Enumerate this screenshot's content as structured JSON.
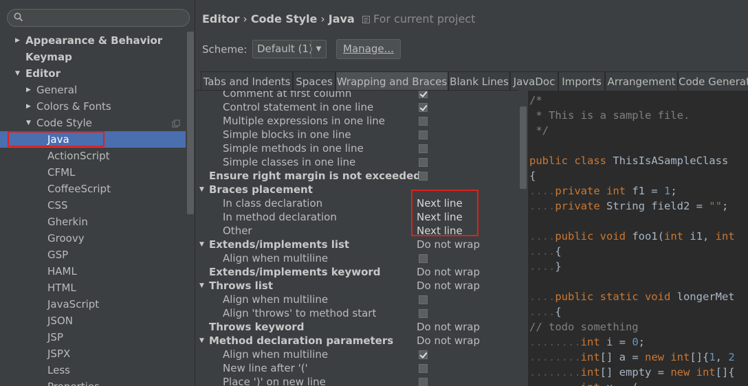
{
  "search": {
    "placeholder": ""
  },
  "sidebar": {
    "top": [
      {
        "label": "Appearance & Behavior",
        "arrow": "▶"
      },
      {
        "label": "Keymap",
        "arrow": ""
      },
      {
        "label": "Editor",
        "arrow": "▼"
      }
    ],
    "editor_children": [
      {
        "label": "General",
        "arrow": "▶"
      },
      {
        "label": "Colors & Fonts",
        "arrow": "▶"
      },
      {
        "label": "Code Style",
        "arrow": "▼"
      }
    ],
    "languages": [
      "Java",
      "ActionScript",
      "CFML",
      "CoffeeScript",
      "CSS",
      "Gherkin",
      "Groovy",
      "GSP",
      "HAML",
      "HTML",
      "JavaScript",
      "JSON",
      "JSP",
      "JSPX",
      "Less",
      "Properties"
    ],
    "selected": "Java"
  },
  "breadcrumb": {
    "items": [
      "Editor",
      "Code Style",
      "Java"
    ],
    "separator": "›",
    "project": "For current project"
  },
  "scheme": {
    "label": "Scheme:",
    "value": "Default (1)",
    "manage": "Manage..."
  },
  "tabs": [
    "Tabs and Indents",
    "Spaces",
    "Wrapping and Braces",
    "Blank Lines",
    "JavaDoc",
    "Imports",
    "Arrangement",
    "Code Generation"
  ],
  "active_tab": "Wrapping and Braces",
  "settings": [
    {
      "name": "Comment at first column",
      "indent": 1,
      "kind": "checkbox",
      "checked": true
    },
    {
      "name": "Control statement in one line",
      "indent": 1,
      "kind": "checkbox",
      "checked": true
    },
    {
      "name": "Multiple expressions in one line",
      "indent": 1,
      "kind": "checkbox",
      "checked": false
    },
    {
      "name": "Simple blocks in one line",
      "indent": 1,
      "kind": "checkbox",
      "checked": false
    },
    {
      "name": "Simple methods in one line",
      "indent": 1,
      "kind": "checkbox",
      "checked": false
    },
    {
      "name": "Simple classes in one line",
      "indent": 1,
      "kind": "checkbox",
      "checked": false
    },
    {
      "name": "Ensure right margin is not exceeded",
      "indent": 0,
      "bold": true,
      "kind": "checkbox",
      "checked": false
    },
    {
      "name": "Braces placement",
      "indent": 0,
      "bold": true,
      "group": true,
      "kind": "none"
    },
    {
      "name": "In class declaration",
      "indent": 1,
      "kind": "value",
      "value": "Next line"
    },
    {
      "name": "In method declaration",
      "indent": 1,
      "kind": "value",
      "value": "Next line"
    },
    {
      "name": "Other",
      "indent": 1,
      "kind": "value",
      "value": "Next line"
    },
    {
      "name": "Extends/implements list",
      "indent": 0,
      "bold": true,
      "group": true,
      "kind": "value",
      "value": "Do not wrap"
    },
    {
      "name": "Align when multiline",
      "indent": 1,
      "kind": "checkbox",
      "checked": false
    },
    {
      "name": "Extends/implements keyword",
      "indent": 0,
      "bold": true,
      "kind": "value",
      "value": "Do not wrap"
    },
    {
      "name": "Throws list",
      "indent": 0,
      "bold": true,
      "group": true,
      "kind": "value",
      "value": "Do not wrap"
    },
    {
      "name": "Align when multiline",
      "indent": 1,
      "kind": "checkbox",
      "checked": false
    },
    {
      "name": "Align 'throws' to method start",
      "indent": 1,
      "kind": "checkbox",
      "checked": false
    },
    {
      "name": "Throws keyword",
      "indent": 0,
      "bold": true,
      "kind": "value",
      "value": "Do not wrap"
    },
    {
      "name": "Method declaration parameters",
      "indent": 0,
      "bold": true,
      "group": true,
      "kind": "value",
      "value": "Do not wrap"
    },
    {
      "name": "Align when multiline",
      "indent": 1,
      "kind": "checkbox",
      "checked": true
    },
    {
      "name": "New line after '('",
      "indent": 1,
      "kind": "checkbox",
      "checked": false
    },
    {
      "name": "Place ')' on new line",
      "indent": 1,
      "kind": "checkbox",
      "checked": false
    }
  ],
  "code": [
    [
      [
        "cmt",
        "/*"
      ]
    ],
    [
      [
        "cmt",
        " * This is a sample file."
      ]
    ],
    [
      [
        "cmt",
        " */"
      ]
    ],
    [],
    [
      [
        "kw",
        "public class "
      ],
      [
        "plain",
        "ThisIsASampleClass "
      ]
    ],
    [
      [
        "plain",
        "{"
      ]
    ],
    [
      [
        "dot",
        "...."
      ],
      [
        "kw",
        "private int "
      ],
      [
        "plain",
        "f1 = "
      ],
      [
        "num",
        "1"
      ],
      [
        "plain",
        ";"
      ]
    ],
    [
      [
        "dot",
        "...."
      ],
      [
        "kw",
        "private "
      ],
      [
        "plain",
        "String field2 = "
      ],
      [
        "str",
        "\"\""
      ],
      [
        "plain",
        ";"
      ]
    ],
    [],
    [
      [
        "dot",
        "...."
      ],
      [
        "kw",
        "public void "
      ],
      [
        "plain",
        "foo1("
      ],
      [
        "kw",
        "int "
      ],
      [
        "plain",
        "i1, "
      ],
      [
        "kw",
        "int"
      ]
    ],
    [
      [
        "dot",
        "...."
      ],
      [
        "plain",
        "{"
      ]
    ],
    [
      [
        "dot",
        "...."
      ],
      [
        "plain",
        "}"
      ]
    ],
    [],
    [
      [
        "dot",
        "...."
      ],
      [
        "kw",
        "public static void "
      ],
      [
        "plain",
        "longerMet"
      ]
    ],
    [
      [
        "dot",
        "...."
      ],
      [
        "plain",
        "{"
      ]
    ],
    [
      [
        "cmt",
        "// todo something"
      ]
    ],
    [
      [
        "dot",
        "........"
      ],
      [
        "kw",
        "int "
      ],
      [
        "plain",
        "i = "
      ],
      [
        "num",
        "0"
      ],
      [
        "plain",
        ";"
      ]
    ],
    [
      [
        "dot",
        "........"
      ],
      [
        "kw",
        "int"
      ],
      [
        "plain",
        "[] a = "
      ],
      [
        "kw",
        "new int"
      ],
      [
        "plain",
        "[]{"
      ],
      [
        "num",
        "1"
      ],
      [
        "plain",
        ", "
      ],
      [
        "num",
        "2"
      ]
    ],
    [
      [
        "dot",
        "........"
      ],
      [
        "kw",
        "int"
      ],
      [
        "plain",
        "[] empty = "
      ],
      [
        "kw",
        "new int"
      ],
      [
        "plain",
        "[]{"
      ]
    ],
    [
      [
        "dot",
        "........"
      ],
      [
        "kw",
        "int "
      ],
      [
        "plain",
        "x = ("
      ]
    ]
  ],
  "colors": {
    "bg": "#3c3f41",
    "selection": "#4b6eaf",
    "highlight_box": "#e0201e",
    "editor_bg": "#2b2b2b",
    "keyword": "#cc7832",
    "number": "#6897bb",
    "string": "#6a8759",
    "comment": "#808080"
  }
}
